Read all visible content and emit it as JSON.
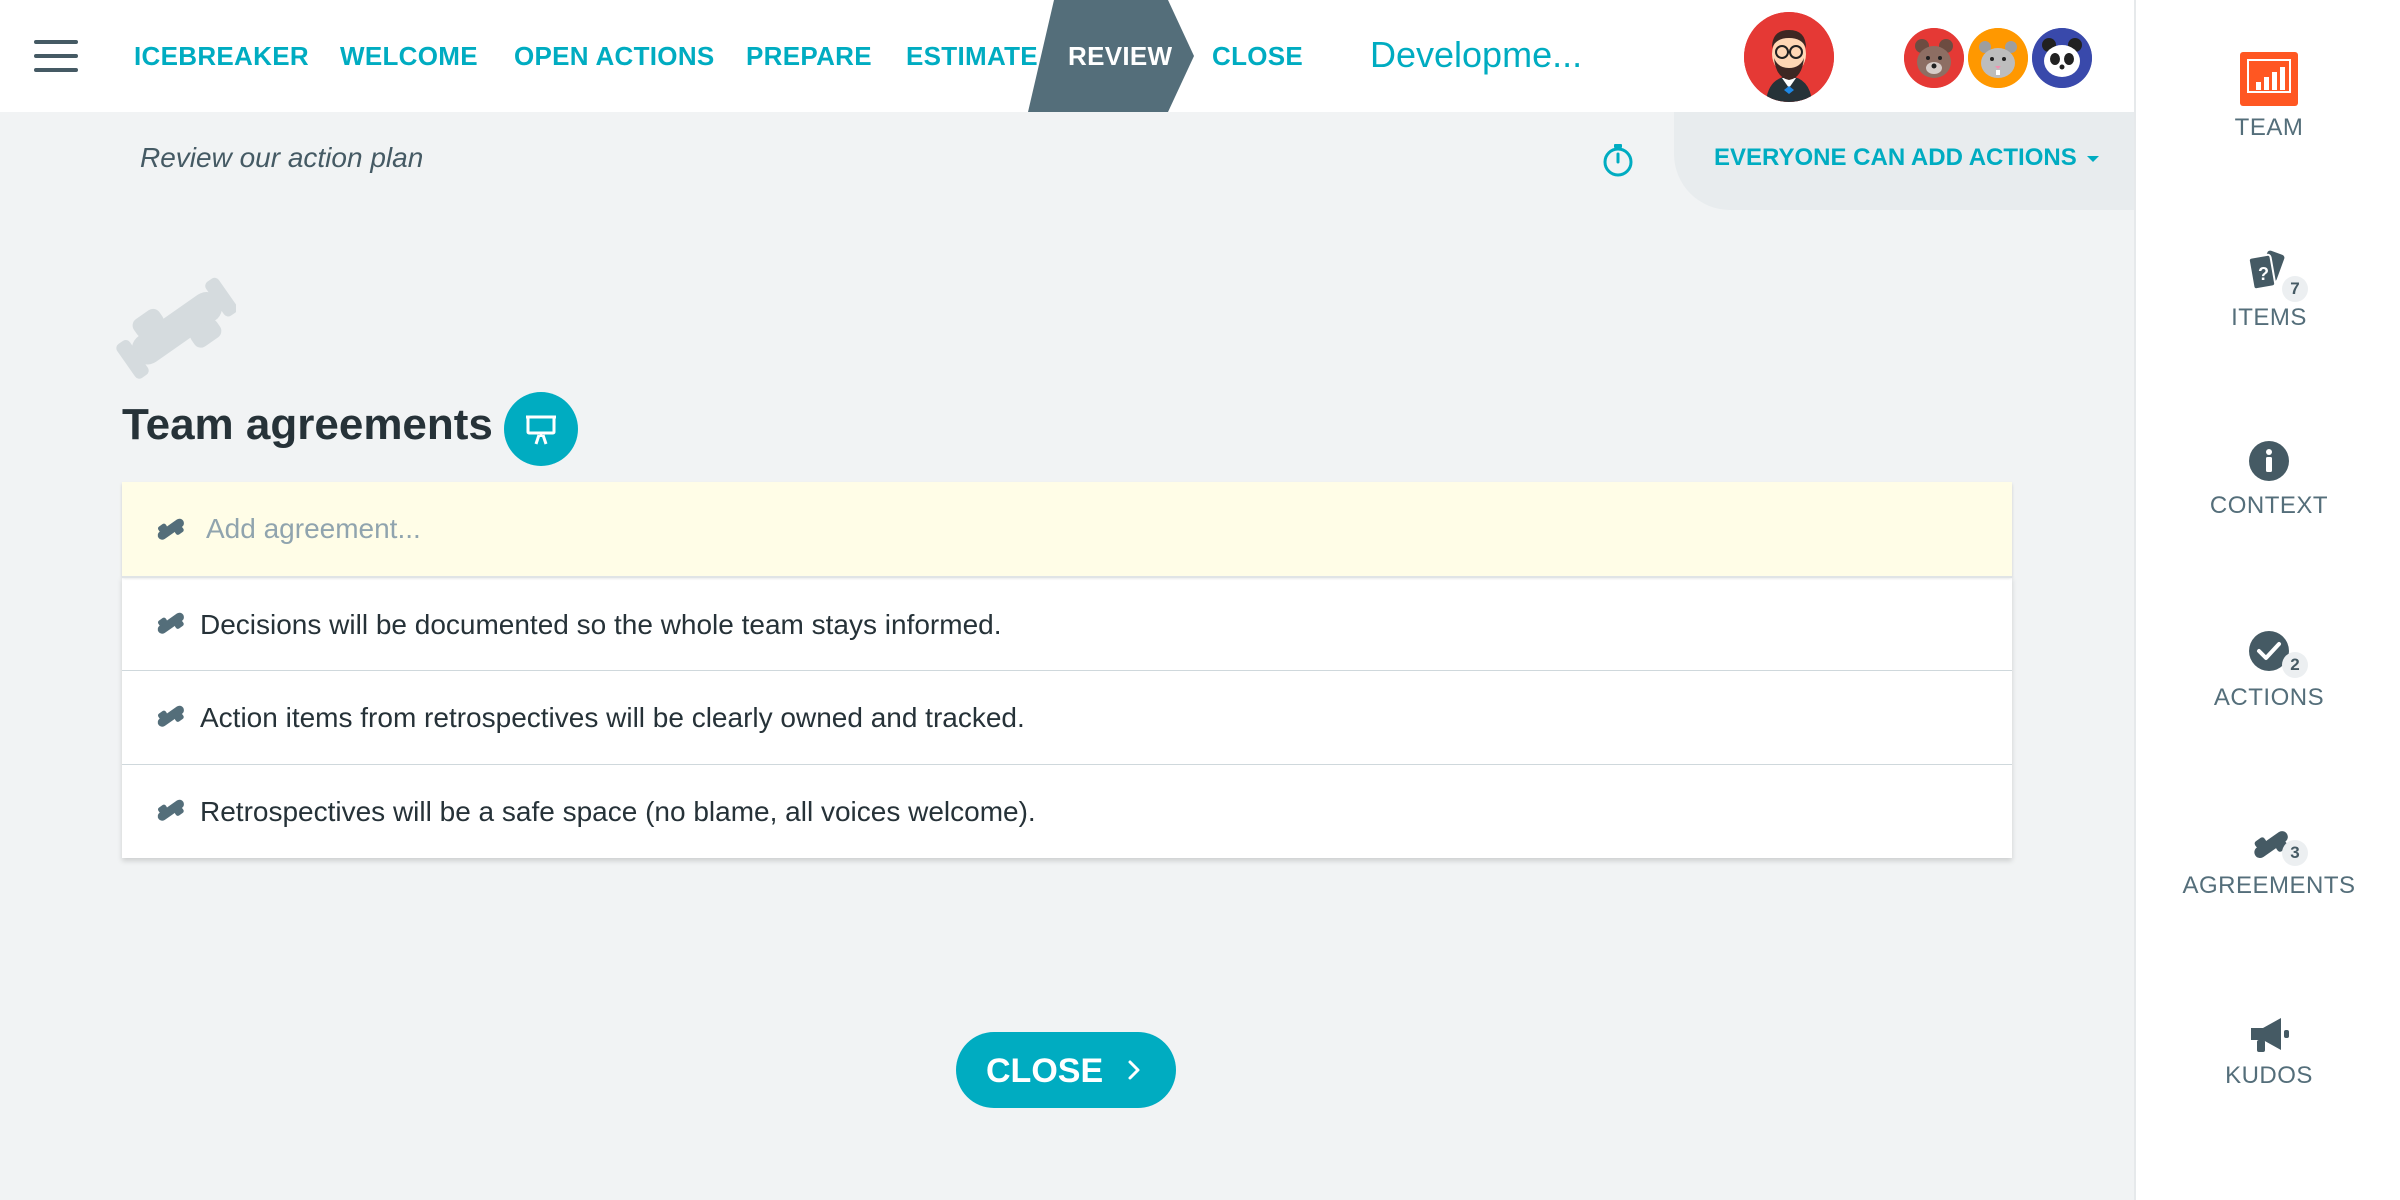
{
  "nav": {
    "menu_icon": "hamburger-icon",
    "steps": [
      {
        "label": "ICEBREAKER",
        "active": false
      },
      {
        "label": "WELCOME",
        "active": false
      },
      {
        "label": "OPEN ACTIONS",
        "active": false
      },
      {
        "label": "PREPARE",
        "active": false
      },
      {
        "label": "ESTIMATE",
        "active": false
      },
      {
        "label": "REVIEW",
        "active": true
      },
      {
        "label": "CLOSE",
        "active": false
      }
    ],
    "board_title": "Developme..."
  },
  "participants": {
    "host": "bearded-man-avatar",
    "others": [
      "bear-avatar",
      "hamster-avatar",
      "panda-avatar"
    ]
  },
  "subbar": {
    "subtitle": "Review our action plan",
    "timer_icon": "stopwatch-icon",
    "permission_label": "EVERYONE CAN ADD ACTIONS"
  },
  "main": {
    "section_title": "Team agreements",
    "present_icon": "presentation-icon",
    "add_placeholder": "Add agreement...",
    "agreements": [
      "Decisions will be documented so the whole team stays informed.",
      "Action items from retrospectives will be clearly owned and tracked.",
      "Retrospectives will be a safe space (no blame, all voices welcome)."
    ],
    "close_button": "CLOSE"
  },
  "sidebar": {
    "items": [
      {
        "label": "TEAM",
        "icon": "team-board-icon",
        "badge": ""
      },
      {
        "label": "ITEMS",
        "icon": "cards-icon",
        "badge": "7"
      },
      {
        "label": "CONTEXT",
        "icon": "info-icon",
        "badge": ""
      },
      {
        "label": "ACTIONS",
        "icon": "check-circle-icon",
        "badge": "2"
      },
      {
        "label": "AGREEMENTS",
        "icon": "handshake-icon",
        "badge": "3"
      },
      {
        "label": "KUDOS",
        "icon": "megaphone-icon",
        "badge": ""
      }
    ]
  },
  "colors": {
    "accent": "#00acc1",
    "active_step": "#546e7a",
    "background": "#f1f3f4",
    "input_highlight": "#fffde7",
    "team_icon": "#ff5722"
  }
}
